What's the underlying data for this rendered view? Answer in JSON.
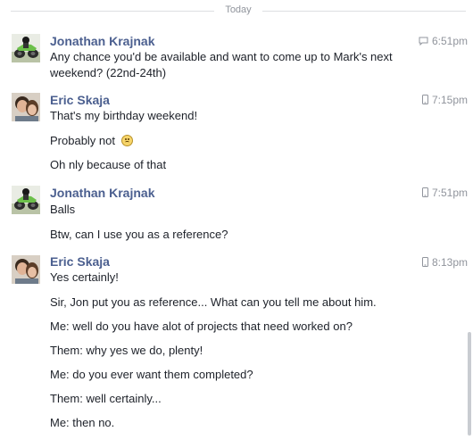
{
  "divider": {
    "label": "Today"
  },
  "groups": [
    {
      "sender": "Jonathan Krajnak",
      "time": "6:51pm",
      "time_icon": "chat-icon",
      "messages": [
        "Any chance you'd be available and want to come up to Mark's next",
        "weekend? (22nd-24th)"
      ]
    },
    {
      "sender": "Eric Skaja",
      "time": "7:15pm",
      "time_icon": "mobile-icon",
      "messages": [
        "That's my birthday weekend!",
        "Probably not",
        "Oh nly because of that"
      ]
    },
    {
      "sender": "Jonathan Krajnak",
      "time": "7:51pm",
      "time_icon": "mobile-icon",
      "messages": [
        "Balls",
        "Btw, can I use you as a reference?"
      ]
    },
    {
      "sender": "Eric Skaja",
      "time": "8:13pm",
      "time_icon": "mobile-icon",
      "messages": [
        "Yes certainly!",
        "Sir, Jon put you as reference... What can you tell me about him.",
        "Me: well do you have alot of projects that need worked on?",
        "Them: why yes we do, plenty!",
        "Me: do you ever want them completed?",
        "Them: well certainly...",
        "Me: then no."
      ]
    }
  ]
}
